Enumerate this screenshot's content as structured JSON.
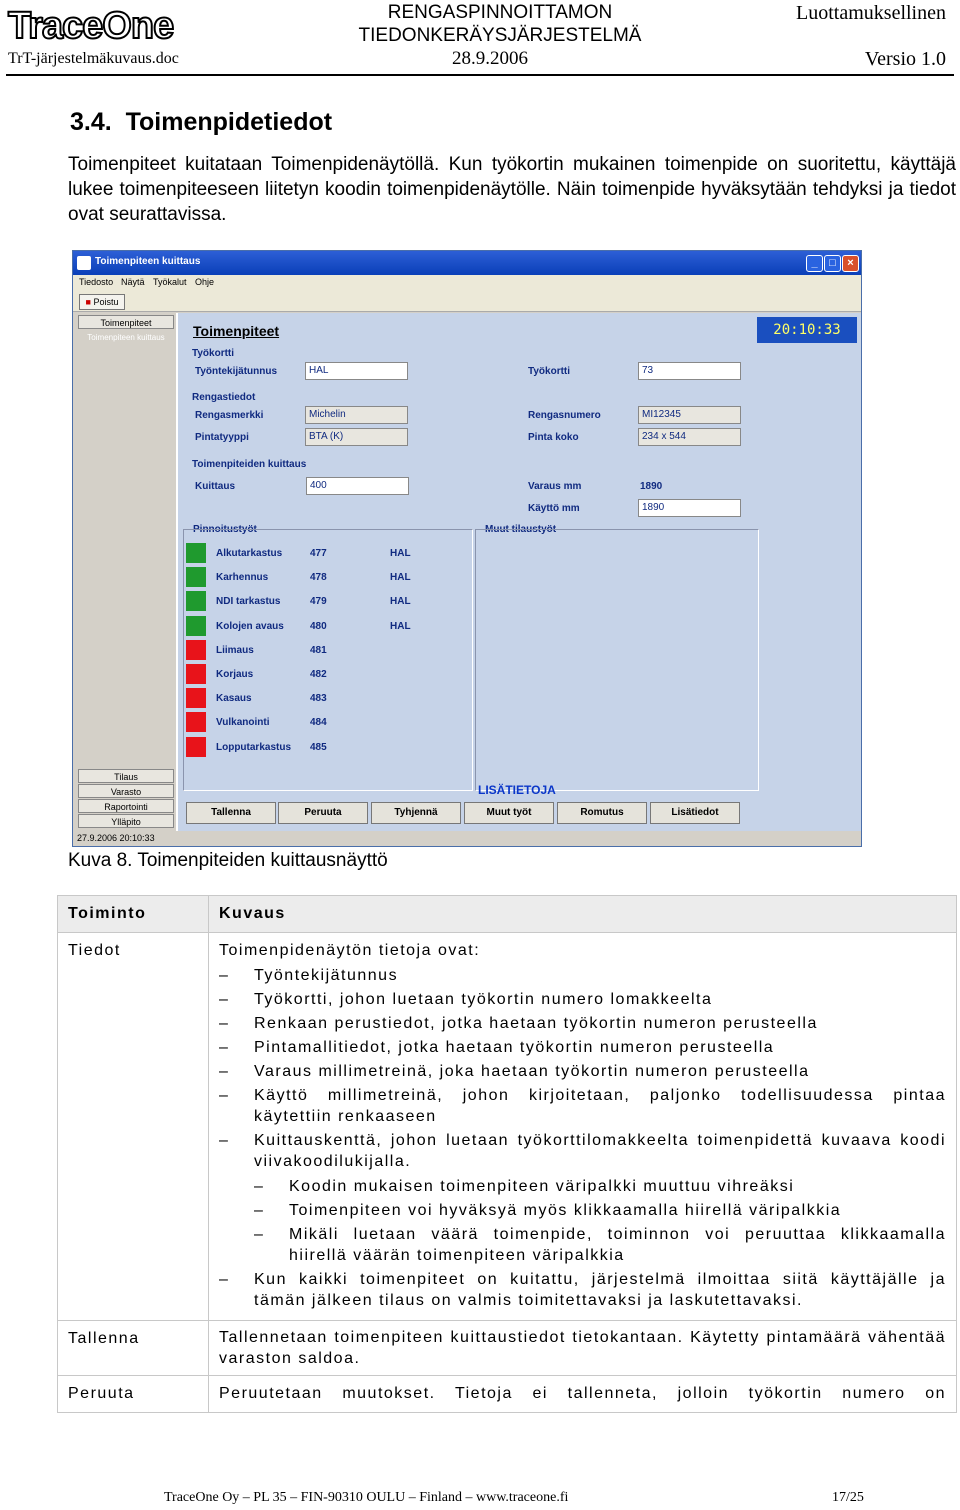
{
  "header": {
    "logo_text": "TraceOne",
    "title_line1": "RENGASPINNOITTAMON",
    "title_line2": "TIEDONKERÄYSJÄRJESTELMÄ",
    "confidential": "Luottamuksellinen",
    "filename": "TrT-järjestelmäkuvaus.doc",
    "date": "28.9.2006",
    "version": "Versio 1.0"
  },
  "section": {
    "number": "3.4.",
    "title": "Toimenpidetiedot",
    "paragraph": "Toimenpiteet kuitataan Toimenpidenäytöllä. Kun työkortin mukainen toimenpide on suoritettu, käyttäjä lukee toimenpiteeseen liitetyn koodin toimenpidenäytölle. Näin toimenpide hyväksytään tehdyksi ja tiedot ovat seurattavissa."
  },
  "window": {
    "title": "Toimenpiteen kuittaus",
    "menu": [
      "Tiedosto",
      "Näytä",
      "Työkalut",
      "Ohje"
    ],
    "toolbar_button": "Poistu",
    "nav_top": [
      "Toimenpiteet",
      "Toimenpiteen kuittaus"
    ],
    "nav_bottom": [
      "Tilaus",
      "Varasto",
      "Raportointi",
      "Ylläpito"
    ],
    "heading": "Toimenpiteet",
    "clock": "20:10:33",
    "tyokortti_group": "Työkortti",
    "tyontekijatunnus_label": "Työntekijätunnus",
    "tyontekijatunnus_value": "HAL",
    "tyokortti_label": "Työkortti",
    "tyokortti_value": "73",
    "rengas_group": "Rengastiedot",
    "rengasmerkki_label": "Rengasmerkki",
    "rengasmerkki_value": "Michelin",
    "rengasnumero_label": "Rengasnumero",
    "rengasnumero_value": "MI12345",
    "pintatyyppi_label": "Pintatyyppi",
    "pintatyyppi_value": "BTA (K)",
    "pintakoko_label": "Pinta koko",
    "pintakoko_value": "234 x 544",
    "kuittaus_group": "Toimenpiteiden kuittaus",
    "kuittaus_label": "Kuittaus",
    "kuittaus_value": "400",
    "varaus_label": "Varaus mm",
    "varaus_value": "1890",
    "kaytto_label": "Käyttö mm",
    "kaytto_value": "1890",
    "pinnoitus_group": "Pinnoitustyöt",
    "muut_group": "Muut tilaustyöt",
    "operations": [
      {
        "name": "Alkutarkastus",
        "code": "477",
        "user": "HAL",
        "color": "#1f9a2e"
      },
      {
        "name": "Karhennus",
        "code": "478",
        "user": "HAL",
        "color": "#1f9a2e"
      },
      {
        "name": "NDI tarkastus",
        "code": "479",
        "user": "HAL",
        "color": "#1f9a2e"
      },
      {
        "name": "Kolojen avaus",
        "code": "480",
        "user": "HAL",
        "color": "#1f9a2e"
      },
      {
        "name": "Liimaus",
        "code": "481",
        "user": "",
        "color": "#e8131a"
      },
      {
        "name": "Korjaus",
        "code": "482",
        "user": "",
        "color": "#e8131a"
      },
      {
        "name": "Kasaus",
        "code": "483",
        "user": "",
        "color": "#e8131a"
      },
      {
        "name": "Vulkanointi",
        "code": "484",
        "user": "",
        "color": "#e8131a"
      },
      {
        "name": "Lopputarkastus",
        "code": "485",
        "user": "",
        "color": "#e8131a"
      }
    ],
    "lisatietoja": "LISÄTIETOJA",
    "buttons": [
      "Tallenna",
      "Peruuta",
      "Tyhjennä",
      "Muut työt",
      "Romutus",
      "Lisätiedot"
    ],
    "status": "27.9.2006 20:10:33"
  },
  "caption": "Kuva 8. Toimenpiteiden kuittausnäyttö",
  "table": {
    "col1": "Toiminto",
    "col2": "Kuvaus",
    "rows": {
      "tiedot_label": "Tiedot",
      "tiedot_intro": "Toimenpidenäytön tietoja ovat:",
      "tiedot_items": [
        "Työntekijätunnus",
        "Työkortti, johon luetaan työkortin numero lomakkeelta",
        "Renkaan perustiedot, jotka haetaan työkortin numeron perusteella",
        "Pintamallitiedot, jotka haetaan työkortin numeron perusteella",
        "Varaus millimetreinä, joka haetaan työkortin numeron perusteella",
        "Käyttö millimetreinä, johon kirjoitetaan, paljonko todellisuudessa pintaa käytettiin renkaaseen",
        "Kuittauskenttä, johon luetaan työkorttilomakkeelta toimenpidettä kuvaava koodi viivakoodilukijalla."
      ],
      "tiedot_subitems": [
        "Koodin mukaisen toimenpiteen väripalkki muuttuu vihreäksi",
        "Toimenpiteen voi hyväksyä myös klikkaamalla hiirellä väripalkkia",
        "Mikäli luetaan väärä toimenpide, toiminnon voi peruuttaa klikkaamalla hiirellä väärän toimenpiteen väripalkkia"
      ],
      "tiedot_last": "Kun kaikki toimenpiteet on kuitattu, järjestelmä ilmoittaa siitä käyttäjälle ja tämän jälkeen tilaus on valmis toimitettavaksi ja laskutettavaksi.",
      "tallenna_label": "Tallenna",
      "tallenna_text": "Tallennetaan toimenpiteen kuittaustiedot tietokantaan. Käytetty pintamäärä vähentää varaston saldoa.",
      "peruuta_label": "Peruuta",
      "peruuta_text": "Peruutetaan muutokset. Tietoja ei tallenneta, jolloin työkortin numero on"
    }
  },
  "footer": {
    "address": "TraceOne Oy – PL 35 – FIN-90310 OULU – Finland – www.traceone.fi",
    "page": "17/25"
  }
}
